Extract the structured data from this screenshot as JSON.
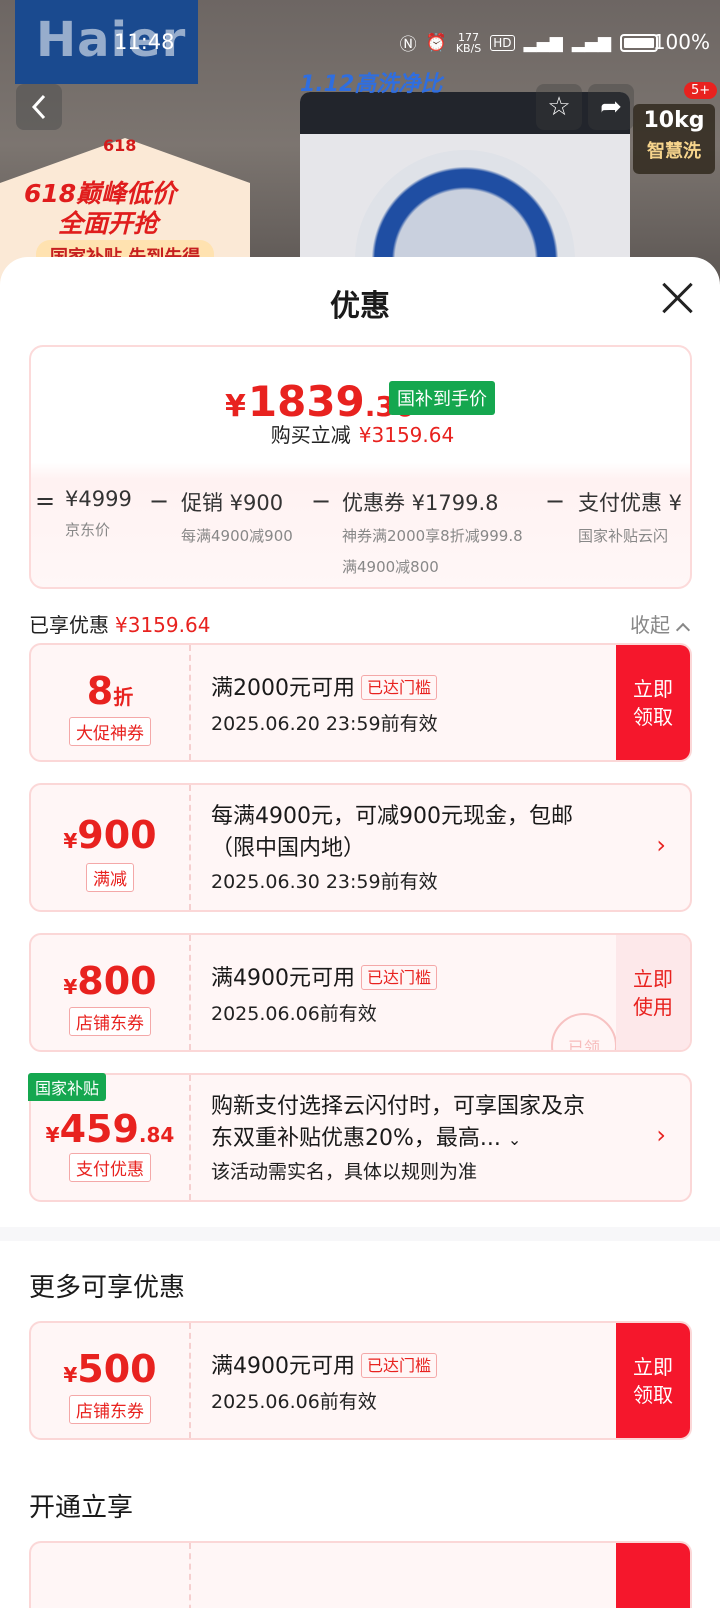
{
  "background": {
    "brand": "Haier",
    "ratio_badge": "1.12高洗净比",
    "capacity": "10kg",
    "smart_wash": "智慧洗",
    "promo_small": "618",
    "promo_line1": "618巅峰低价",
    "promo_line2": "全面开抢",
    "promo_line3": "国家补贴 先到先得"
  },
  "status_bar": {
    "time": "11:48",
    "speed": "177",
    "speed_unit": "KB/S",
    "battery": "100%"
  },
  "nav": {
    "back_icon": "chevron-left-icon",
    "notif_badge": "5+"
  },
  "sheet": {
    "title": "优惠"
  },
  "price_card": {
    "currency": "¥",
    "price_int": "1839",
    "price_dec": ".36",
    "subsidy_tag": "国补到手价",
    "reduce_label": "购买立减",
    "reduce_amount": "¥3159.64",
    "breakdown": {
      "eq": "=",
      "jd_price": "¥4999",
      "jd_label": "京东价",
      "minus": "−",
      "promo": "促销 ¥900",
      "promo_sub": "每满4900减900",
      "coupon": "优惠券 ¥1799.8",
      "coupon_sub1": "神券满2000享8折减999.8",
      "coupon_sub2": "满4900减800",
      "pay": "支付优惠 ¥",
      "pay_sub": "国家补贴云闪"
    }
  },
  "enjoyed": {
    "label": "已享优惠",
    "amount": "¥3159.64",
    "collapse": "收起"
  },
  "coupons": [
    {
      "num": "8",
      "unit": "折",
      "tag": "大促神券",
      "title": "满2000元可用",
      "reached": "已达门槛",
      "sub": "2025.06.20 23:59前有效",
      "action_line1": "立即",
      "action_line2": "领取"
    },
    {
      "cur": "¥",
      "num": "900",
      "tag": "满减",
      "title_line1": "每满4900元，可减900元现金，包邮",
      "title_line2": "（限中国内地）",
      "sub": "2025.06.30 23:59前有效"
    },
    {
      "cur": "¥",
      "num": "800",
      "tag": "店铺东券",
      "title": "满4900元可用",
      "reached": "已达门槛",
      "sub": "2025.06.06前有效",
      "action_line1": "立即",
      "action_line2": "使用",
      "stamp": "已领"
    },
    {
      "nat_tag": "国家补贴",
      "cur": "¥",
      "num": "459",
      "dec": ".84",
      "tag": "支付优惠",
      "title_line1": "购新支付选择云闪付时，可享国家及京",
      "title_line2": "东双重补贴优惠20%，最高...",
      "sub": "该活动需实名，具体以规则为准"
    }
  ],
  "more": {
    "title": "更多可享优惠",
    "coupon": {
      "cur": "¥",
      "num": "500",
      "tag": "店铺东券",
      "title": "满4900元可用",
      "reached": "已达门槛",
      "sub": "2025.06.06前有效",
      "action_line1": "立即",
      "action_line2": "领取"
    }
  },
  "open": {
    "title": "开通立享"
  }
}
